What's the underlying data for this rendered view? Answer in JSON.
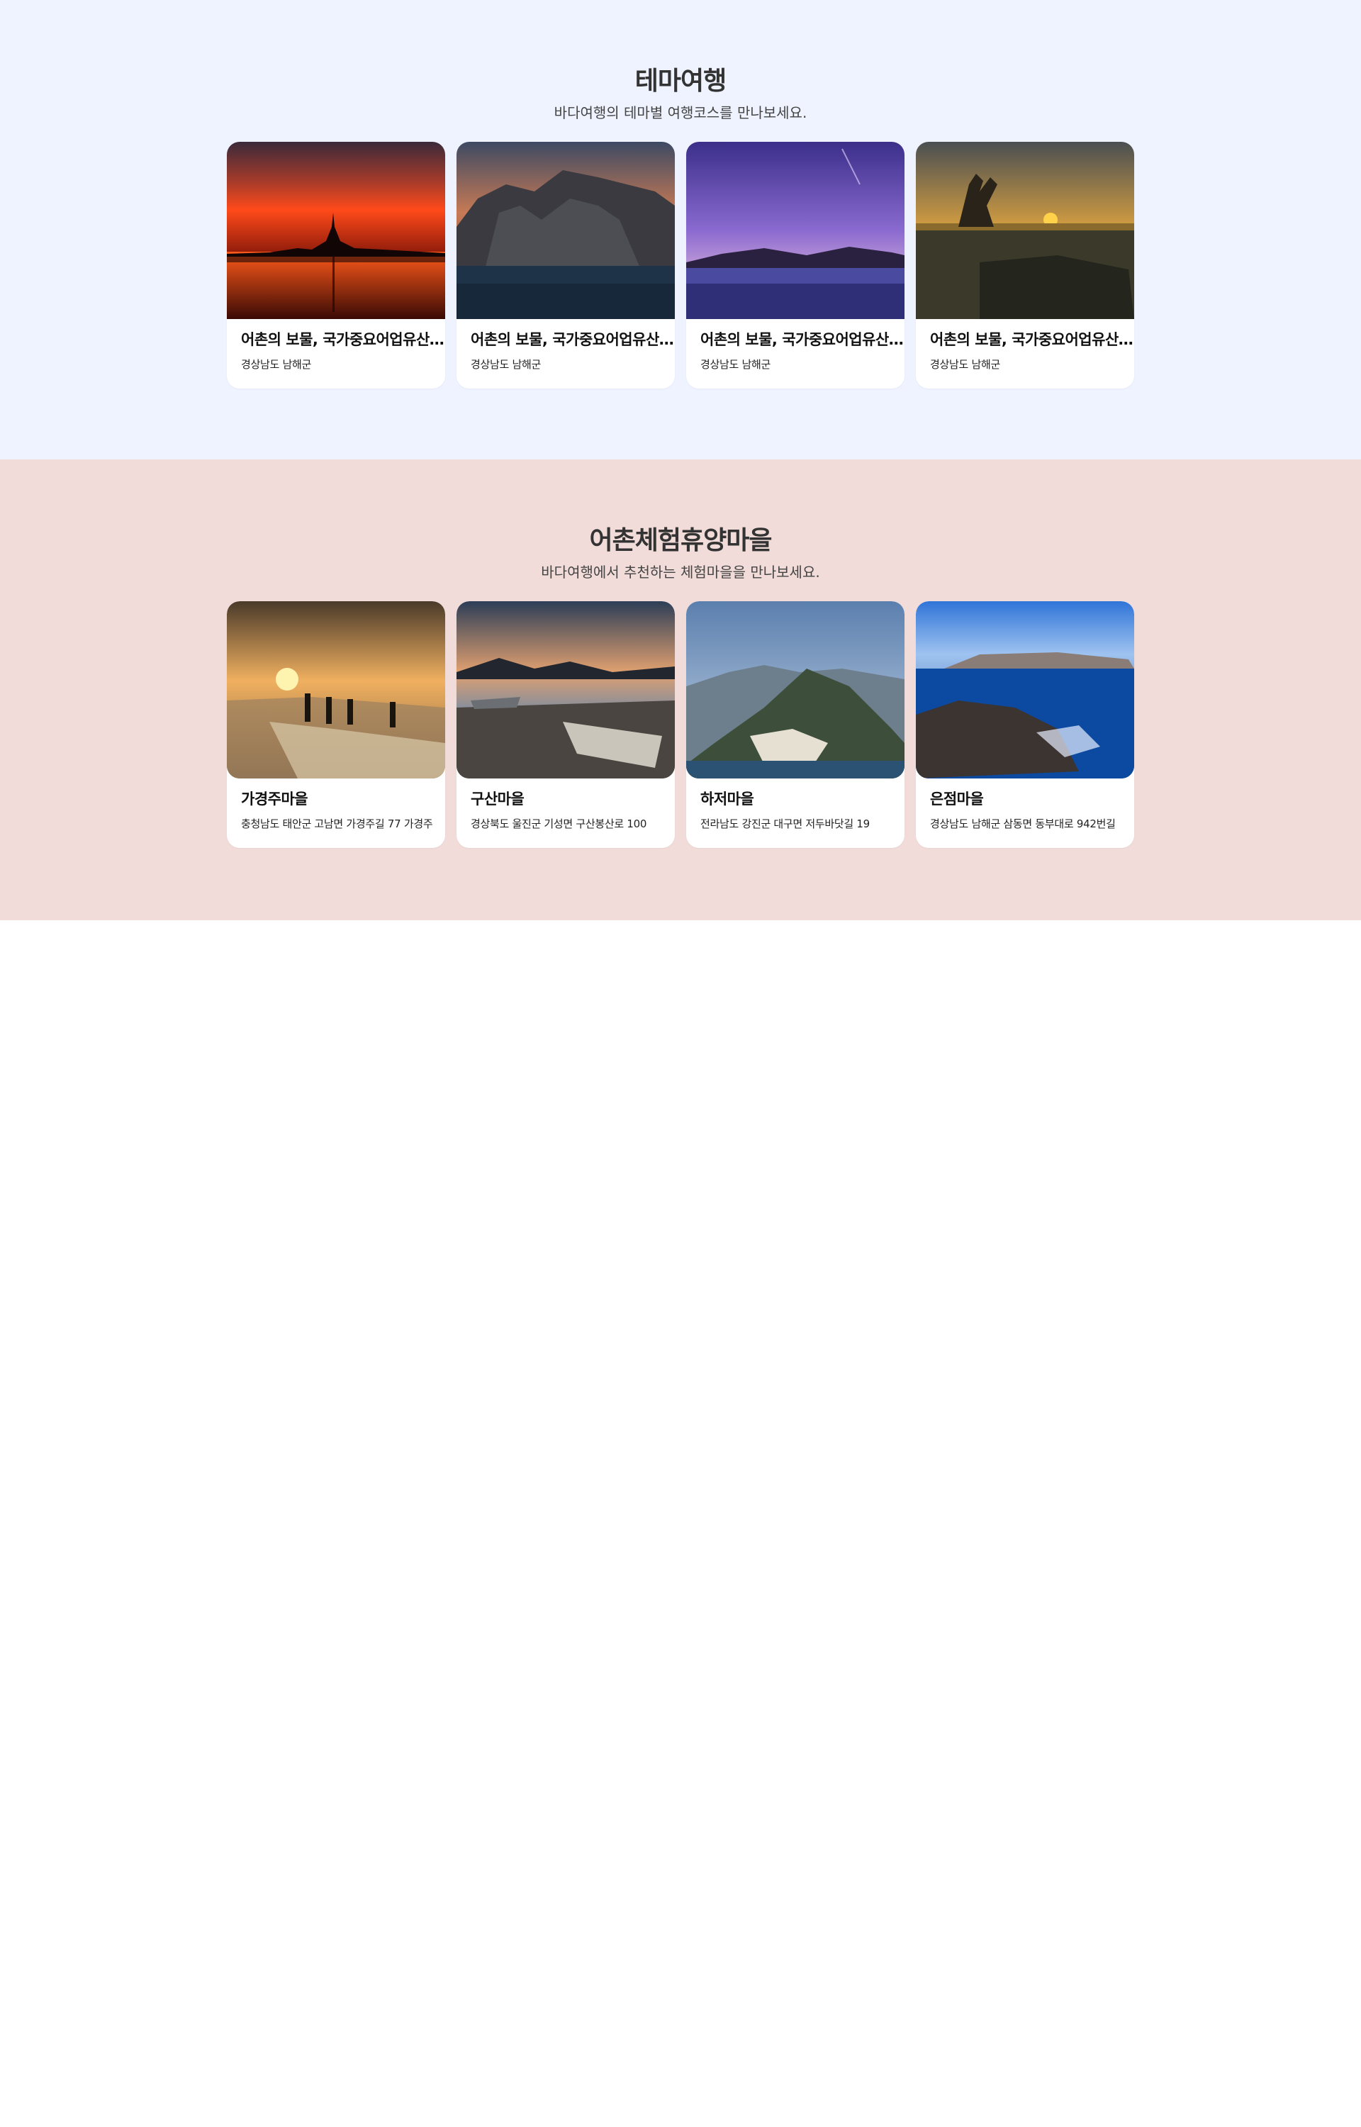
{
  "theme_section": {
    "title": "테마여행",
    "subtitle": "바다여행의 테마별 여행코스를 만나보세요.",
    "cards": [
      {
        "title": "어촌의 보물, 국가중요어업유산 남해 죽방렴",
        "address": "경상남도 남해군",
        "image": "sunset-city-silhouette"
      },
      {
        "title": "어촌의 보물, 국가중요어업유산 남해 죽방렴",
        "address": "경상남도 남해군",
        "image": "sea-cliff-sunset"
      },
      {
        "title": "어촌의 보물, 국가중요어업유산 남해 죽방렴",
        "address": "경상남도 남해군",
        "image": "purple-sky-lake"
      },
      {
        "title": "어촌의 보물, 국가중요어업유산 남해 죽방렴",
        "address": "경상남도 남해군",
        "image": "hand-sculpture-sea"
      }
    ]
  },
  "village_section": {
    "title": "어촌체험휴양마을",
    "subtitle": "바다여행에서 추천하는 체험마을을 만나보세요.",
    "cards": [
      {
        "title": "가경주마을",
        "address": "충청남도 태안군 고남면 가경주길 77 가경주",
        "image": "fishermen-sunset"
      },
      {
        "title": "구산마을",
        "address": "경상북도 울진군 기성면 구산봉산로 100",
        "image": "boats-lake"
      },
      {
        "title": "하저마을",
        "address": "전라남도 강진군 대구면 저두바닷길 19",
        "image": "mountain-village"
      },
      {
        "title": "은점마을",
        "address": "경상남도 남해군 삼동면 동부대로 942번길",
        "image": "rocky-coast"
      }
    ]
  }
}
